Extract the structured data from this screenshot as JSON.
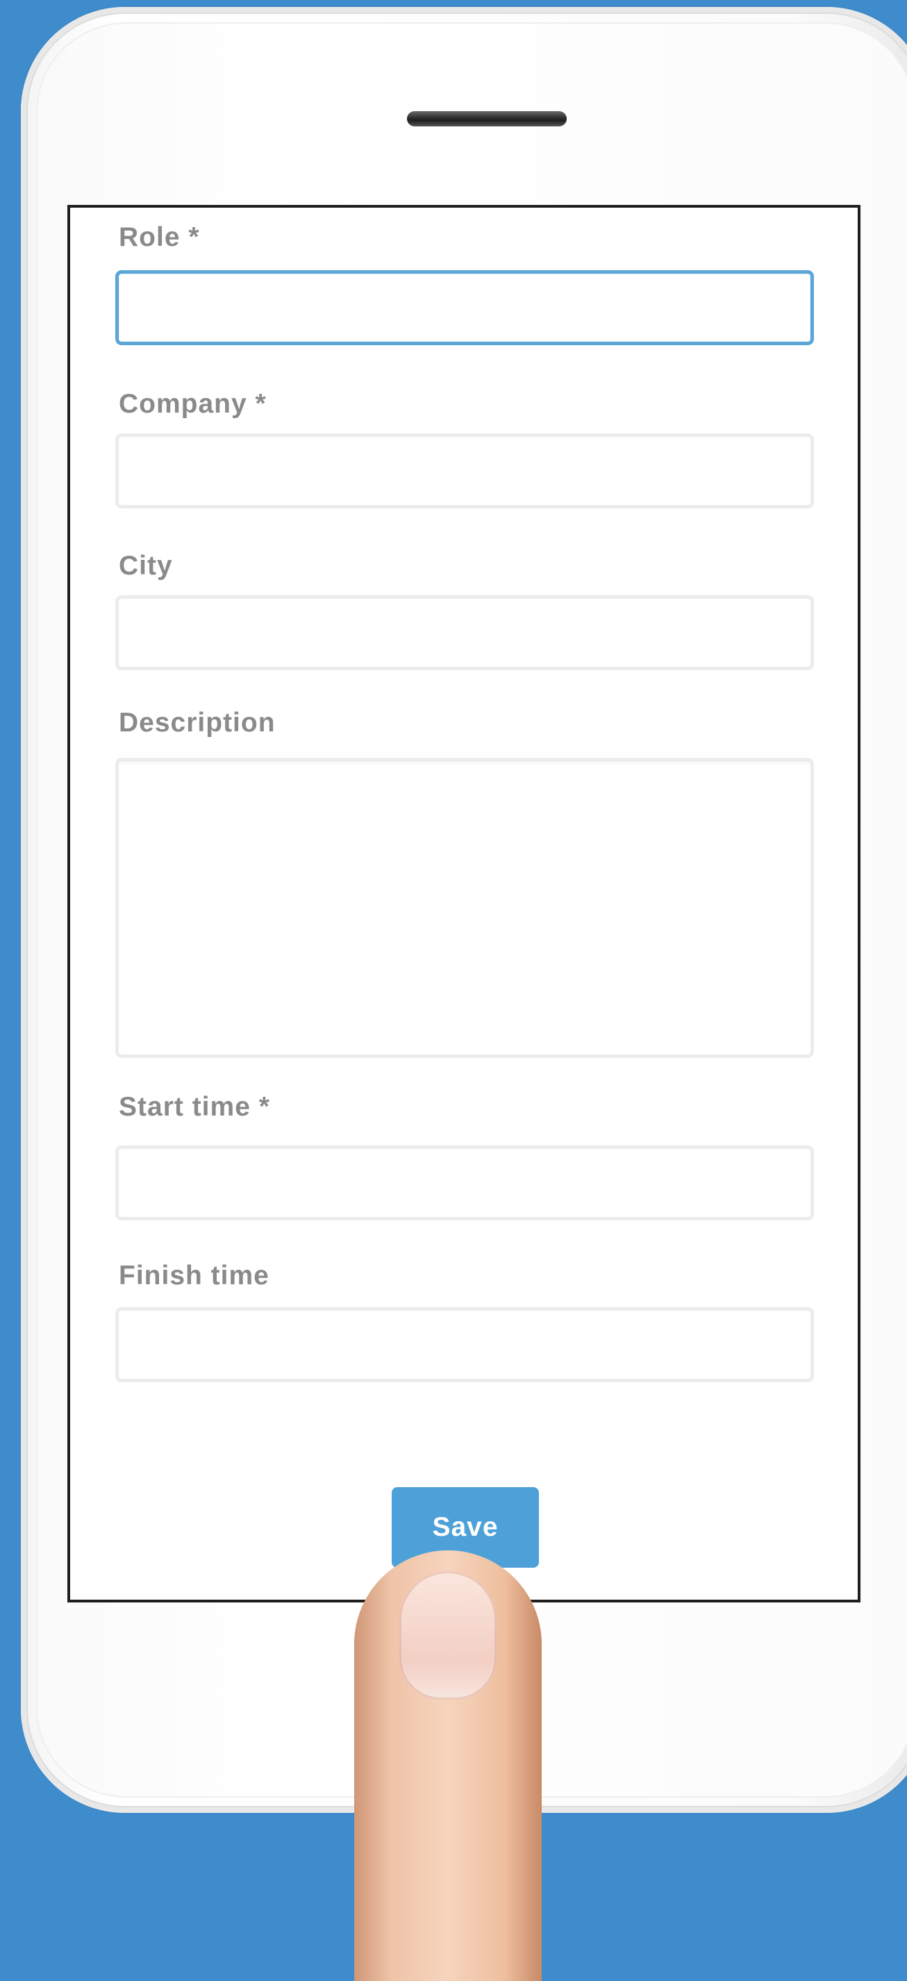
{
  "form": {
    "fields": [
      {
        "label": "Role *",
        "value": "",
        "active": true
      },
      {
        "label": "Company *",
        "value": ""
      },
      {
        "label": "City",
        "value": ""
      },
      {
        "label": "Description",
        "value": "",
        "multiline": true
      },
      {
        "label": "Start time *",
        "value": ""
      },
      {
        "label": "Finish time",
        "value": ""
      }
    ],
    "save_label": "Save"
  },
  "colors": {
    "background": "#3f8ccd",
    "accent": "#4da0d8",
    "label": "#8a8a8a",
    "active_border": "#5aa6d6"
  }
}
